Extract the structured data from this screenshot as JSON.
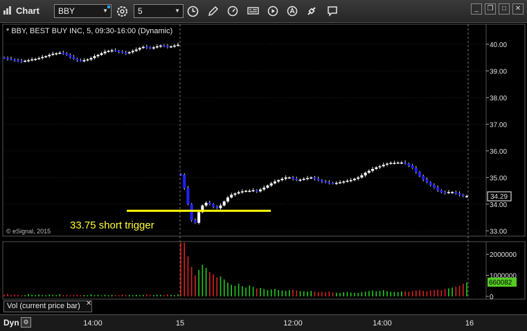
{
  "window": {
    "title": "Chart",
    "symbol": "BBY",
    "interval": "5"
  },
  "legend": {
    "text": "* BBY, BEST BUY INC, 5, 09:30-16:00 (Dynamic)",
    "copyright": "© eSignal, 2015"
  },
  "annotation": {
    "label": "33.75 short trigger",
    "level": 33.75,
    "color": "#ffff00"
  },
  "price_axis": {
    "ticks": [
      "40.00",
      "39.00",
      "38.00",
      "37.00",
      "36.00",
      "35.00",
      "34.00",
      "33.00"
    ],
    "last_price": "34.29"
  },
  "volume_axis": {
    "ticks": [
      "2000000",
      "1000000",
      "0"
    ],
    "current_volume": "660082"
  },
  "volume_panel": {
    "title": "Vol (current price bar)",
    "close_symbol": "✕"
  },
  "time_axis": {
    "mode": "Dyn",
    "labels": [
      "14:00",
      "15",
      "12:00",
      "14:00",
      "16"
    ]
  },
  "colors": {
    "up_candle": "#ffffff",
    "down_candle": "#2020ff",
    "volume_up": "#22cc22",
    "volume_down": "#dd2222",
    "last_volume_badge": "#55cc22",
    "background": "#000000"
  },
  "chart_data": {
    "type": "candlestick",
    "ylim": [
      32.8,
      40.75
    ],
    "price_series_day1": [
      39.48,
      39.45,
      39.43,
      39.4,
      39.37,
      39.36,
      39.38,
      39.4,
      39.43,
      39.45,
      39.48,
      39.52,
      39.55,
      39.6,
      39.64,
      39.66,
      39.68,
      39.66,
      39.6,
      39.52,
      39.45,
      39.4,
      39.38,
      39.4,
      39.43,
      39.48,
      39.55,
      39.6,
      39.66,
      39.72,
      39.75,
      39.77,
      39.75,
      39.72,
      39.68,
      39.66,
      39.7,
      39.75,
      39.8,
      39.86,
      39.9,
      39.88,
      39.85,
      39.88,
      39.92,
      39.95,
      39.93,
      39.9,
      39.92,
      39.95,
      39.98
    ],
    "price_series_day2": [
      35.1,
      34.6,
      34.0,
      33.4,
      33.3,
      33.7,
      33.95,
      34.05,
      34.0,
      33.9,
      33.85,
      33.95,
      34.1,
      34.25,
      34.35,
      34.4,
      34.45,
      34.48,
      34.5,
      34.5,
      34.52,
      34.48,
      34.55,
      34.62,
      34.7,
      34.78,
      34.85,
      34.9,
      34.95,
      35.0,
      35.0,
      34.95,
      34.9,
      34.92,
      34.95,
      34.98,
      35.0,
      34.95,
      34.9,
      34.85,
      34.82,
      34.8,
      34.78,
      34.8,
      34.82,
      34.85,
      34.88,
      34.9,
      34.95,
      35.0,
      35.08,
      35.18,
      35.25,
      35.32,
      35.38,
      35.42,
      35.48,
      35.52,
      35.55,
      35.55,
      35.56,
      35.56,
      35.52,
      35.45,
      35.35,
      35.2,
      35.05,
      34.92,
      34.82,
      34.72,
      34.62,
      34.52,
      34.45,
      34.42,
      34.45,
      34.45,
      34.4,
      34.35,
      34.3,
      34.3
    ],
    "volume_series_day1": [
      80000,
      120000,
      60000,
      90000,
      70000,
      50000,
      60000,
      110000,
      75000,
      65000,
      90000,
      60000,
      55000,
      85000,
      70000,
      60000,
      95000,
      60000,
      70000,
      50000,
      65000,
      80000,
      60000,
      70000,
      55000,
      100000,
      60000,
      75000,
      50000,
      85000,
      60000,
      70000,
      65000,
      55000,
      90000,
      60000,
      70000,
      50000,
      80000,
      60000,
      70000,
      90000,
      65000,
      60000,
      80000,
      70000,
      60000,
      100000,
      75000,
      60000,
      90000
    ],
    "volume_series_day2": [
      2550000,
      2550000,
      1900000,
      1400000,
      1000000,
      1250000,
      1500000,
      1350000,
      1150000,
      1050000,
      900000,
      950000,
      800000,
      650000,
      550000,
      500000,
      600000,
      480000,
      420000,
      520000,
      450000,
      380000,
      400000,
      350000,
      300000,
      330000,
      360000,
      300000,
      280000,
      260000,
      300000,
      320000,
      280000,
      250000,
      240000,
      230000,
      260000,
      220000,
      200000,
      210000,
      190000,
      230000,
      180000,
      170000,
      160000,
      200000,
      210000,
      180000,
      170000,
      160000,
      210000,
      230000,
      250000,
      280000,
      240000,
      260000,
      300000,
      250000,
      220000,
      210000,
      200000,
      230000,
      240000,
      220000,
      250000,
      280000,
      300000,
      260000,
      240000,
      280000,
      300000,
      320000,
      300000,
      350000,
      380000,
      420000,
      450000,
      500000,
      600000,
      660082
    ]
  }
}
